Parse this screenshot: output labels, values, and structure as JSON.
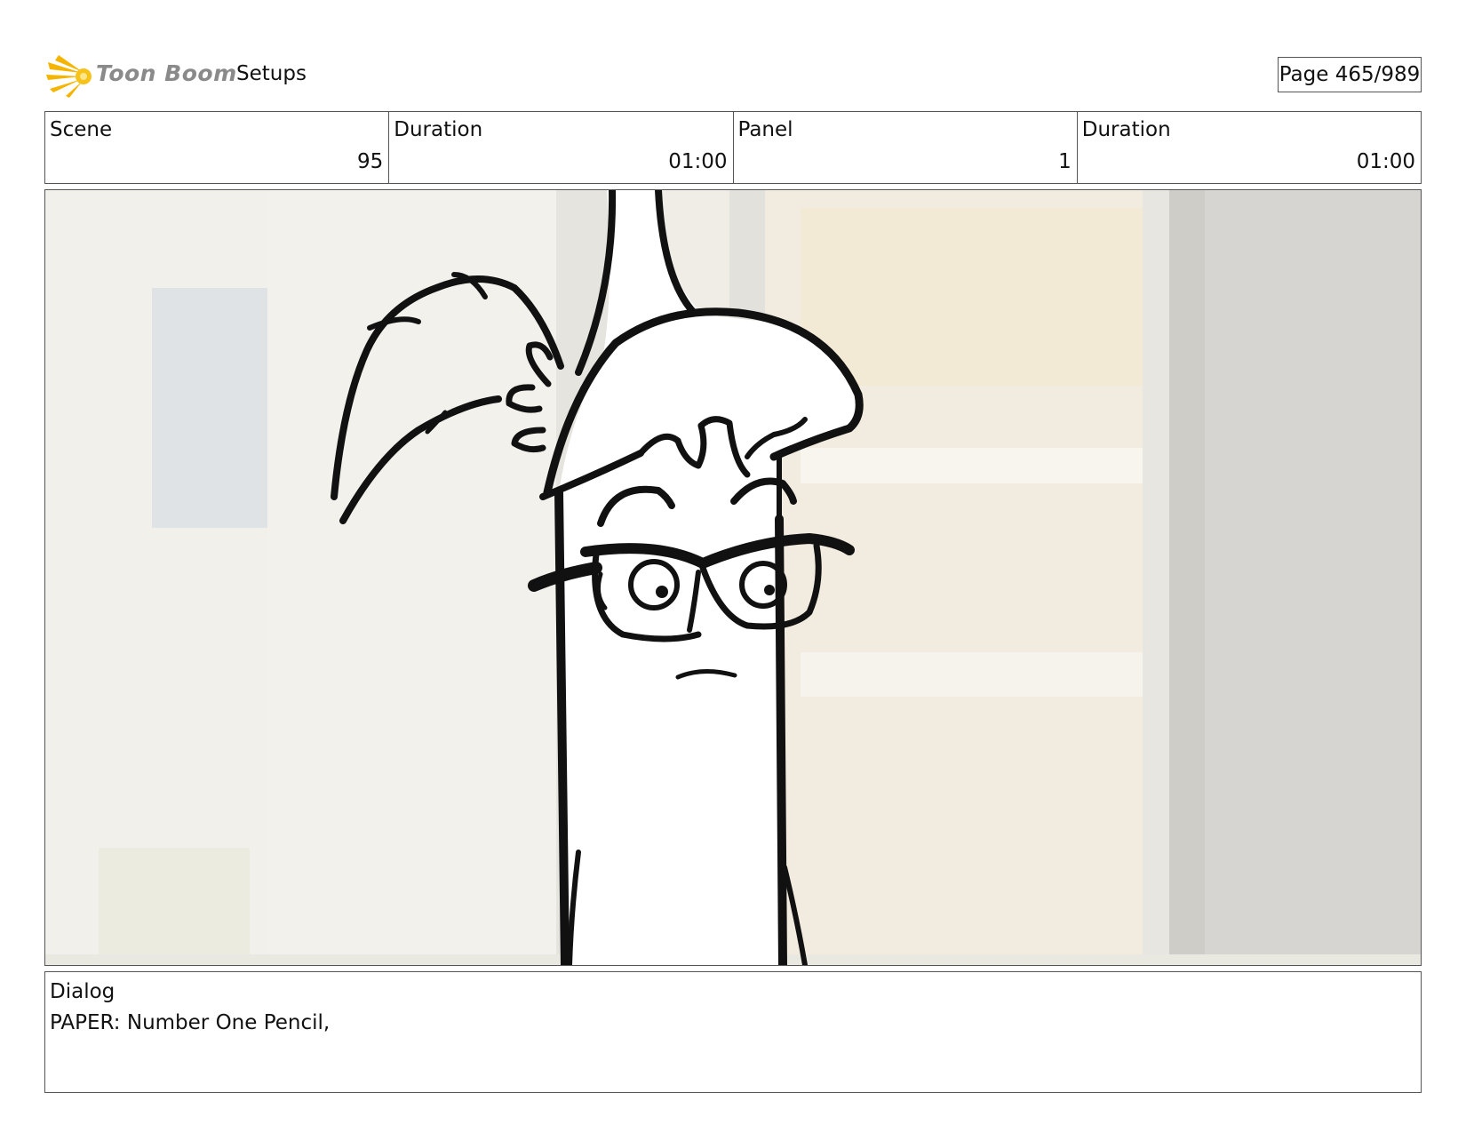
{
  "header": {
    "logo_text": "Toon Boom",
    "project_title": "Setups",
    "page_label": "Page 465/989"
  },
  "info": {
    "scene_label": "Scene",
    "scene_value": "95",
    "scene_duration_label": "Duration",
    "scene_duration_value": "01:00",
    "panel_label": "Panel",
    "panel_value": "1",
    "panel_duration_label": "Duration",
    "panel_duration_value": "01:00"
  },
  "dialog": {
    "label": "Dialog",
    "text": "PAPER: Number One Pencil,"
  },
  "colors": {
    "accent_logo": "#f5b400",
    "border": "#555555"
  }
}
